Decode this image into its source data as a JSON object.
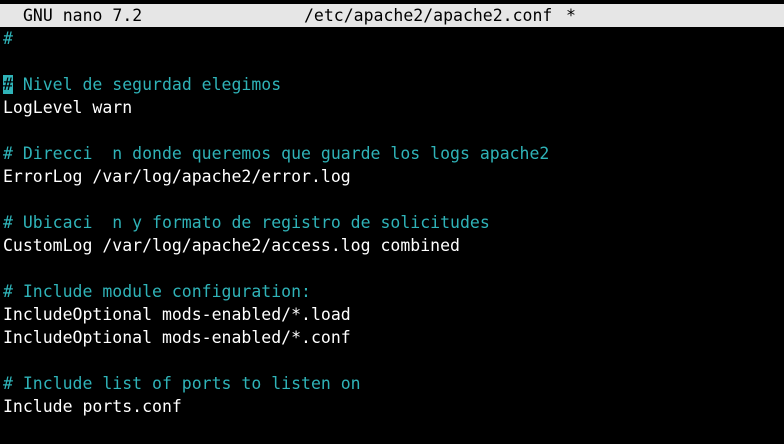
{
  "titlebar": {
    "app": "GNU nano 7.2",
    "file": "/etc/apache2/apache2.conf",
    "modified": "*"
  },
  "colors": {
    "background": "#000000",
    "titlebar_bg": "#e6e6e6",
    "text": "#ffffff",
    "comment": "#2fb3b8"
  },
  "editor": {
    "lines": [
      {
        "text": "#",
        "type": "comment"
      },
      {
        "text": "",
        "type": "blank"
      },
      {
        "text": "# Nivel de segurdad elegimos",
        "type": "comment",
        "cursor": true
      },
      {
        "text": "LogLevel warn",
        "type": "code"
      },
      {
        "text": "",
        "type": "blank"
      },
      {
        "text": "# Direcci  n donde queremos que guarde los logs apache2",
        "type": "comment"
      },
      {
        "text": "ErrorLog /var/log/apache2/error.log",
        "type": "code"
      },
      {
        "text": "",
        "type": "blank"
      },
      {
        "text": "# Ubicaci  n y formato de registro de solicitudes",
        "type": "comment"
      },
      {
        "text": "CustomLog /var/log/apache2/access.log combined",
        "type": "code"
      },
      {
        "text": "",
        "type": "blank"
      },
      {
        "text": "# Include module configuration:",
        "type": "comment"
      },
      {
        "text": "IncludeOptional mods-enabled/*.load",
        "type": "code"
      },
      {
        "text": "IncludeOptional mods-enabled/*.conf",
        "type": "code"
      },
      {
        "text": "",
        "type": "blank"
      },
      {
        "text": "# Include list of ports to listen on",
        "type": "comment"
      },
      {
        "text": "Include ports.conf",
        "type": "code"
      }
    ]
  }
}
